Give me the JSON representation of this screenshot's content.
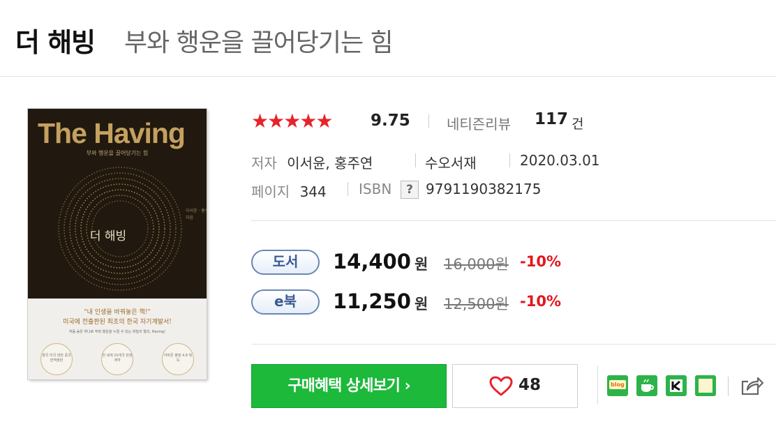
{
  "title": "더 해빙",
  "subtitle": "부와 행운을 끌어당기는 힘",
  "cover": {
    "title_en": "The Having",
    "tagline": "부와 행운을 끌어당기는 힘",
    "title_kr": "더 해빙",
    "authors": "이서윤 · 홍주연 지음",
    "quote1": "\"내 인생을 바꿔놓은 책!\"",
    "quote2": "미국에 전출판된 최초의 한국 자기계발서!",
    "quote3": "처음 숨은 하나로 부와 행운을 누릴 수 있는 비밀의 열쇠, Having!",
    "badges": [
      "영국 미국 대만 중국 번역출판",
      "전 세계 20개국 판권 계약",
      "아마존 평점 4.8 획득"
    ]
  },
  "rating": {
    "stars": "★★★★★",
    "score": "9.75",
    "review_label": "네티즌리뷰",
    "review_count": "117",
    "review_unit": "건",
    "fill_fraction": 0.975
  },
  "meta": {
    "author_label": "저자",
    "authors": "이서윤, 홍주연",
    "publisher": "수오서재",
    "date": "2020.03.01",
    "pages_label": "페이지",
    "pages": "344",
    "isbn_label": "ISBN",
    "isbn_help": "?",
    "isbn": "9791190382175"
  },
  "prices": [
    {
      "type": "도서",
      "price": "14,400",
      "unit": "원",
      "original": "16,000원",
      "discount": "-10%"
    },
    {
      "type": "e북",
      "price": "11,250",
      "unit": "원",
      "original": "12,500원",
      "discount": "-10%"
    }
  ],
  "actions": {
    "buy_label": "구매혜택 상세보기 ›",
    "like_count": "48"
  },
  "share": {
    "icons": [
      "blog-icon",
      "cafe-icon",
      "kakaostory-icon",
      "memo-icon",
      "share-icon"
    ],
    "blog_text": "blog",
    "colors": {
      "green": "#2db34a",
      "accent_red": "#e8232a",
      "price_red": "#e3161c"
    }
  }
}
